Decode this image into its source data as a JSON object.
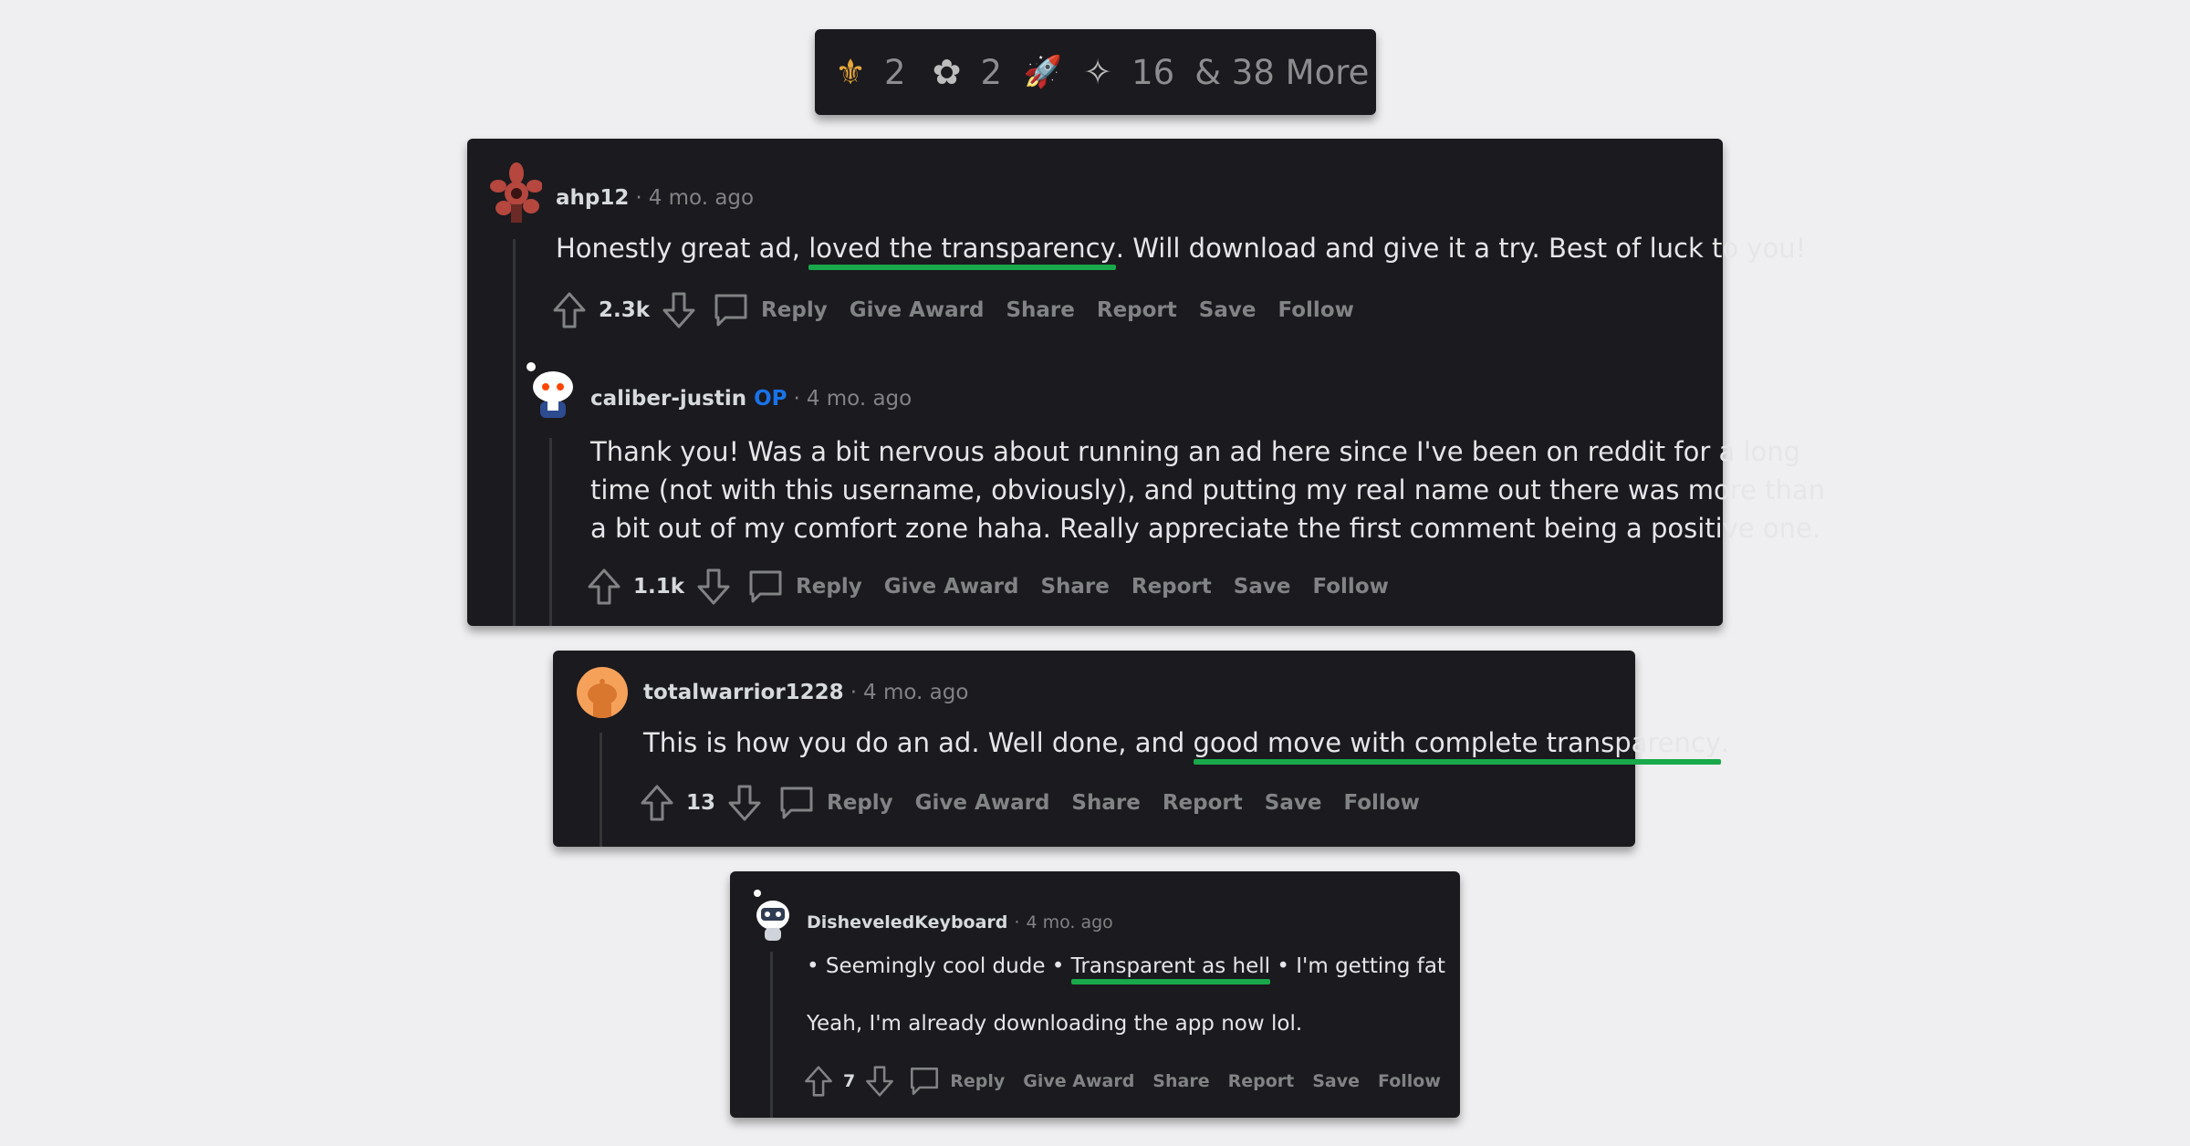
{
  "awards_bar": {
    "items": [
      {
        "icon": "gold-award-icon",
        "glyph": "⚜",
        "color": "#e6a63a",
        "count": "2"
      },
      {
        "icon": "helpful-award-icon",
        "glyph": "✿",
        "color": "#bdbdbd",
        "count": "2"
      },
      {
        "icon": "rocket-award-icon",
        "glyph": "🚀",
        "color": "#d6d6d6",
        "count": ""
      },
      {
        "icon": "wholesome-award-icon",
        "glyph": "✧",
        "color": "#bdbdbd",
        "count": "16"
      }
    ],
    "more": "& 38 More"
  },
  "actions": {
    "reply": "Reply",
    "give_award": "Give Award",
    "share": "Share",
    "report": "Report",
    "save": "Save",
    "follow": "Follow"
  },
  "comments": [
    {
      "user": "ahp12",
      "time": "4 mo. ago",
      "body_pre": "Honestly great ad, ",
      "body_hl": "loved the transparency",
      "body_post": ". Will download and give it a try. Best of luck to you!",
      "score": "2.3k"
    },
    {
      "user": "caliber-justin",
      "op": "OP",
      "time": "4 mo. ago",
      "lines": [
        "Thank you! Was a bit nervous about running an ad here since I've been on reddit for a long",
        "time (not with this username, obviously), and putting my real name out there was more than",
        "a bit out of my comfort zone haha. Really appreciate the first comment being a positive one."
      ],
      "score": "1.1k"
    },
    {
      "user": "totalwarrior1228",
      "time": "4 mo. ago",
      "body_pre": "This is how you do an ad. Well done, and ",
      "body_hl": "good move with complete transparency",
      "body_post": ".",
      "score": "13"
    },
    {
      "user": "DisheveledKeyboard",
      "time": "4 mo. ago",
      "body_pre": "• Seemingly cool dude • ",
      "body_hl": "Transparent as hell",
      "body_post": " • I'm getting fat",
      "line2": "Yeah, I'm already downloading the app now lol.",
      "score": "7"
    }
  ],
  "colors": {
    "card_bg": "#1b1a1e",
    "page_bg": "#efeff1",
    "highlight": "#19a84b",
    "op_blue": "#1a73e8"
  }
}
